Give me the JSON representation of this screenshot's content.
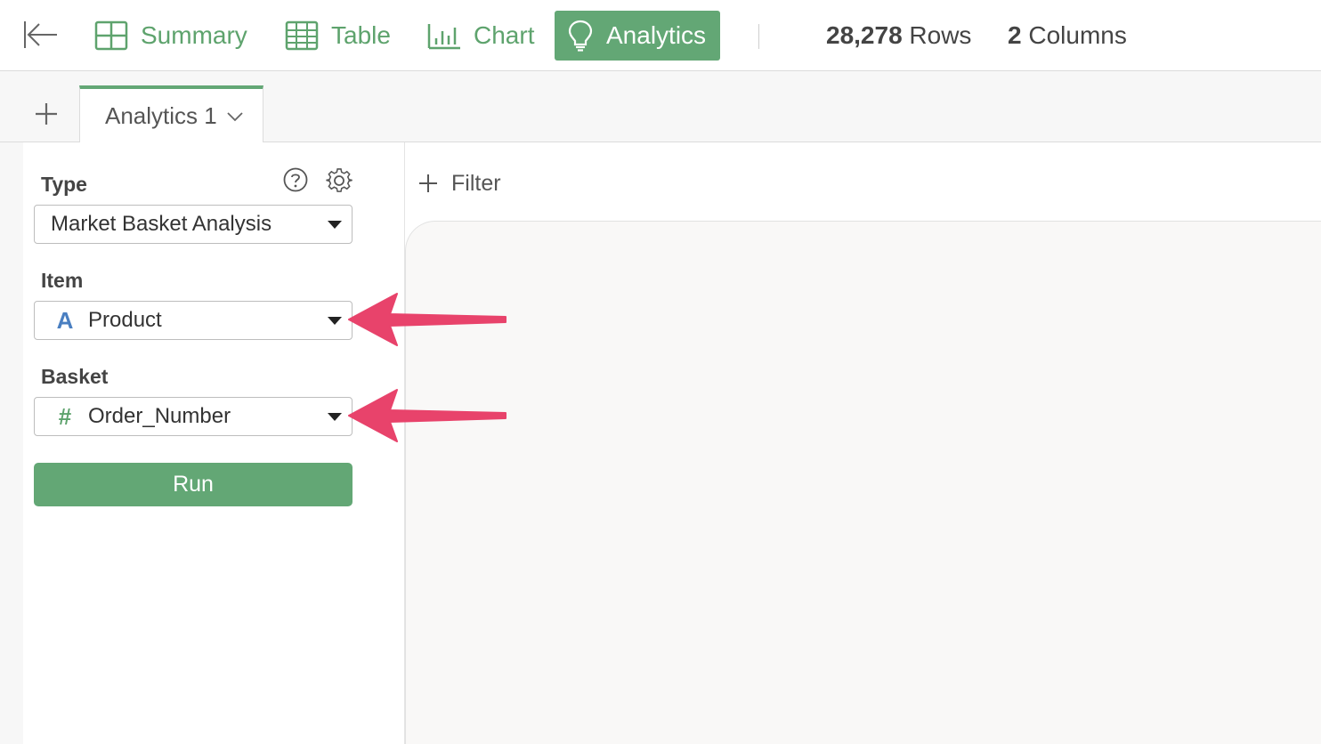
{
  "toolbar": {
    "tabs": [
      {
        "label": "Summary",
        "icon": "summary-grid-icon"
      },
      {
        "label": "Table",
        "icon": "table-icon"
      },
      {
        "label": "Chart",
        "icon": "bar-chart-icon"
      },
      {
        "label": "Analytics",
        "icon": "lightbulb-icon",
        "active": true
      }
    ],
    "rows_count": "28,278",
    "rows_label": "Rows",
    "columns_count": "2",
    "columns_label": "Columns"
  },
  "tabstrip": {
    "add_tab_icon": "plus-icon",
    "active_tab_label": "Analytics 1"
  },
  "panel": {
    "type_label": "Type",
    "type_value": "Market Basket Analysis",
    "item_label": "Item",
    "item_value": "Product",
    "item_type_glyph": "A",
    "basket_label": "Basket",
    "basket_value": "Order_Number",
    "basket_type_glyph": "#",
    "run_label": "Run"
  },
  "main": {
    "filter_label": "Filter"
  },
  "colors": {
    "accent_green": "#63a775",
    "text_type_blue": "#4a7fc1",
    "numeric_type_green": "#5ea36d",
    "annotation_arrow": "#e8436b"
  }
}
